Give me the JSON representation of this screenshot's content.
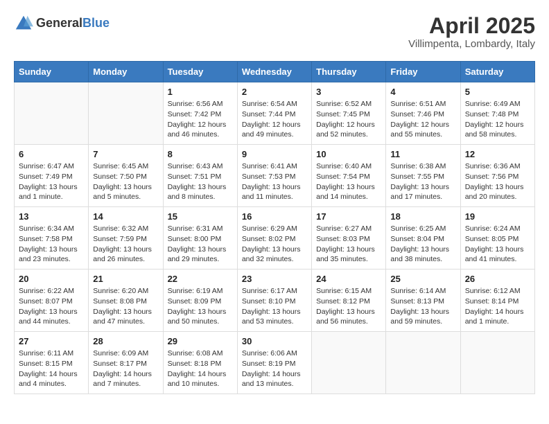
{
  "header": {
    "logo_general": "General",
    "logo_blue": "Blue",
    "month_title": "April 2025",
    "location": "Villimpenta, Lombardy, Italy"
  },
  "days_of_week": [
    "Sunday",
    "Monday",
    "Tuesday",
    "Wednesday",
    "Thursday",
    "Friday",
    "Saturday"
  ],
  "weeks": [
    [
      {
        "day": "",
        "info": ""
      },
      {
        "day": "",
        "info": ""
      },
      {
        "day": "1",
        "info": "Sunrise: 6:56 AM\nSunset: 7:42 PM\nDaylight: 12 hours and 46 minutes."
      },
      {
        "day": "2",
        "info": "Sunrise: 6:54 AM\nSunset: 7:44 PM\nDaylight: 12 hours and 49 minutes."
      },
      {
        "day": "3",
        "info": "Sunrise: 6:52 AM\nSunset: 7:45 PM\nDaylight: 12 hours and 52 minutes."
      },
      {
        "day": "4",
        "info": "Sunrise: 6:51 AM\nSunset: 7:46 PM\nDaylight: 12 hours and 55 minutes."
      },
      {
        "day": "5",
        "info": "Sunrise: 6:49 AM\nSunset: 7:48 PM\nDaylight: 12 hours and 58 minutes."
      }
    ],
    [
      {
        "day": "6",
        "info": "Sunrise: 6:47 AM\nSunset: 7:49 PM\nDaylight: 13 hours and 1 minute."
      },
      {
        "day": "7",
        "info": "Sunrise: 6:45 AM\nSunset: 7:50 PM\nDaylight: 13 hours and 5 minutes."
      },
      {
        "day": "8",
        "info": "Sunrise: 6:43 AM\nSunset: 7:51 PM\nDaylight: 13 hours and 8 minutes."
      },
      {
        "day": "9",
        "info": "Sunrise: 6:41 AM\nSunset: 7:53 PM\nDaylight: 13 hours and 11 minutes."
      },
      {
        "day": "10",
        "info": "Sunrise: 6:40 AM\nSunset: 7:54 PM\nDaylight: 13 hours and 14 minutes."
      },
      {
        "day": "11",
        "info": "Sunrise: 6:38 AM\nSunset: 7:55 PM\nDaylight: 13 hours and 17 minutes."
      },
      {
        "day": "12",
        "info": "Sunrise: 6:36 AM\nSunset: 7:56 PM\nDaylight: 13 hours and 20 minutes."
      }
    ],
    [
      {
        "day": "13",
        "info": "Sunrise: 6:34 AM\nSunset: 7:58 PM\nDaylight: 13 hours and 23 minutes."
      },
      {
        "day": "14",
        "info": "Sunrise: 6:32 AM\nSunset: 7:59 PM\nDaylight: 13 hours and 26 minutes."
      },
      {
        "day": "15",
        "info": "Sunrise: 6:31 AM\nSunset: 8:00 PM\nDaylight: 13 hours and 29 minutes."
      },
      {
        "day": "16",
        "info": "Sunrise: 6:29 AM\nSunset: 8:02 PM\nDaylight: 13 hours and 32 minutes."
      },
      {
        "day": "17",
        "info": "Sunrise: 6:27 AM\nSunset: 8:03 PM\nDaylight: 13 hours and 35 minutes."
      },
      {
        "day": "18",
        "info": "Sunrise: 6:25 AM\nSunset: 8:04 PM\nDaylight: 13 hours and 38 minutes."
      },
      {
        "day": "19",
        "info": "Sunrise: 6:24 AM\nSunset: 8:05 PM\nDaylight: 13 hours and 41 minutes."
      }
    ],
    [
      {
        "day": "20",
        "info": "Sunrise: 6:22 AM\nSunset: 8:07 PM\nDaylight: 13 hours and 44 minutes."
      },
      {
        "day": "21",
        "info": "Sunrise: 6:20 AM\nSunset: 8:08 PM\nDaylight: 13 hours and 47 minutes."
      },
      {
        "day": "22",
        "info": "Sunrise: 6:19 AM\nSunset: 8:09 PM\nDaylight: 13 hours and 50 minutes."
      },
      {
        "day": "23",
        "info": "Sunrise: 6:17 AM\nSunset: 8:10 PM\nDaylight: 13 hours and 53 minutes."
      },
      {
        "day": "24",
        "info": "Sunrise: 6:15 AM\nSunset: 8:12 PM\nDaylight: 13 hours and 56 minutes."
      },
      {
        "day": "25",
        "info": "Sunrise: 6:14 AM\nSunset: 8:13 PM\nDaylight: 13 hours and 59 minutes."
      },
      {
        "day": "26",
        "info": "Sunrise: 6:12 AM\nSunset: 8:14 PM\nDaylight: 14 hours and 1 minute."
      }
    ],
    [
      {
        "day": "27",
        "info": "Sunrise: 6:11 AM\nSunset: 8:15 PM\nDaylight: 14 hours and 4 minutes."
      },
      {
        "day": "28",
        "info": "Sunrise: 6:09 AM\nSunset: 8:17 PM\nDaylight: 14 hours and 7 minutes."
      },
      {
        "day": "29",
        "info": "Sunrise: 6:08 AM\nSunset: 8:18 PM\nDaylight: 14 hours and 10 minutes."
      },
      {
        "day": "30",
        "info": "Sunrise: 6:06 AM\nSunset: 8:19 PM\nDaylight: 14 hours and 13 minutes."
      },
      {
        "day": "",
        "info": ""
      },
      {
        "day": "",
        "info": ""
      },
      {
        "day": "",
        "info": ""
      }
    ]
  ]
}
